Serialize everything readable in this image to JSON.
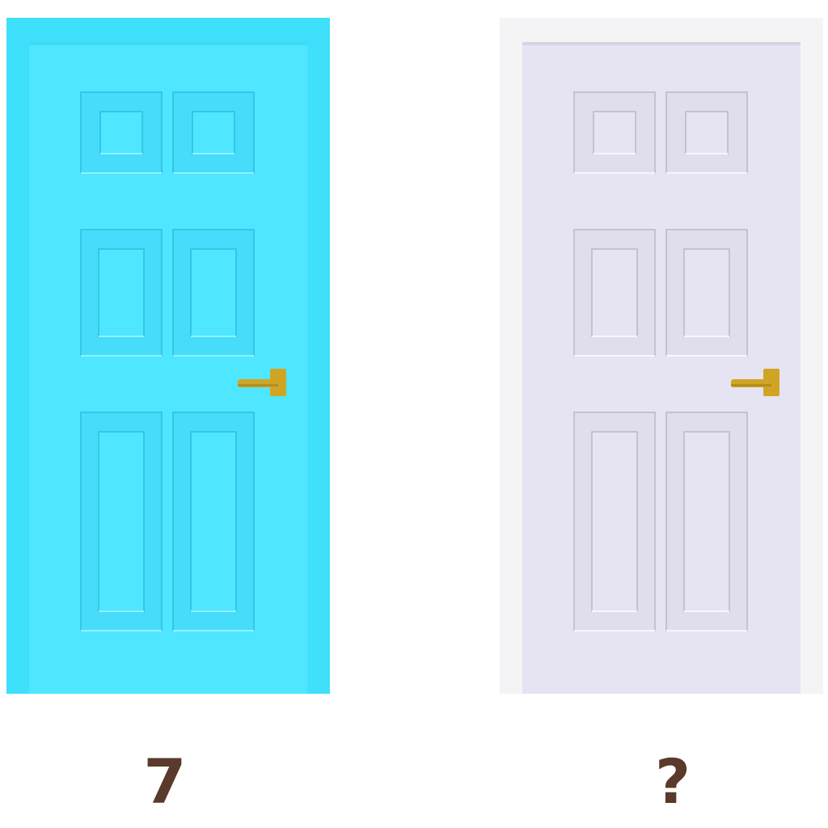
{
  "doors": [
    {
      "label": "7",
      "frame_color": "#3fe0fc",
      "slab_color": "#4fe6ff",
      "panel_color": "#47dcfa",
      "panel_shadow": "#2bbfe0",
      "panel_highlight": "#8ff2ff"
    },
    {
      "label": "?",
      "frame_color": "#f4f4f7",
      "slab_color": "#e6e4f2",
      "panel_color": "#e0deed",
      "panel_shadow": "#b9b6c9",
      "panel_highlight": "#f7f6fc"
    }
  ],
  "handle_color": "#d0a526",
  "label_color": "#5a3a2c",
  "handle_icon": "lever-handle-icon"
}
